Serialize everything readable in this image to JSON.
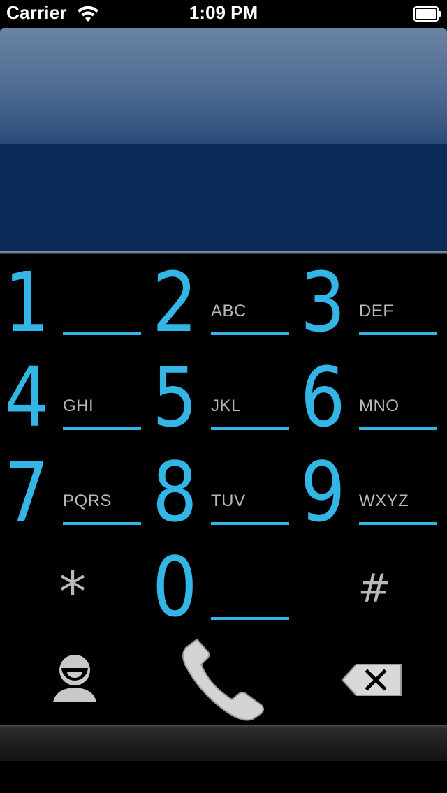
{
  "status_bar": {
    "carrier": "Carrier",
    "time": "1:09 PM",
    "wifi_icon": "wifi-icon",
    "battery_icon": "battery-icon"
  },
  "display": {
    "number": ""
  },
  "colors": {
    "accent": "#33b5e5",
    "display_top": "#5b7398",
    "display_bottom": "#0c2a58",
    "secondary_text": "#b8b8b8"
  },
  "keypad": {
    "keys": [
      {
        "digit": "1",
        "letters": ""
      },
      {
        "digit": "2",
        "letters": "ABC"
      },
      {
        "digit": "3",
        "letters": "DEF"
      },
      {
        "digit": "4",
        "letters": "GHI"
      },
      {
        "digit": "5",
        "letters": "JKL"
      },
      {
        "digit": "6",
        "letters": "MNO"
      },
      {
        "digit": "7",
        "letters": "PQRS"
      },
      {
        "digit": "8",
        "letters": "TUV"
      },
      {
        "digit": "9",
        "letters": "WXYZ"
      },
      {
        "digit": "*",
        "letters": ""
      },
      {
        "digit": "0",
        "letters": ""
      },
      {
        "digit": "#",
        "letters": ""
      }
    ]
  },
  "actions": {
    "contacts_icon": "person-icon",
    "call_icon": "phone-handset-icon",
    "delete_icon": "backspace-icon"
  }
}
